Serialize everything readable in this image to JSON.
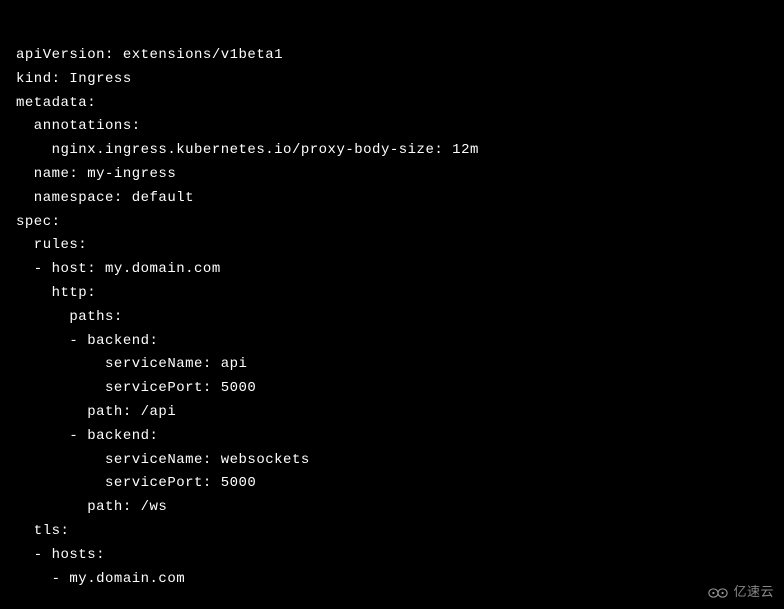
{
  "code": {
    "lines": [
      "apiVersion: extensions/v1beta1",
      "kind: Ingress",
      "metadata:",
      "  annotations:",
      "    nginx.ingress.kubernetes.io/proxy-body-size: 12m",
      "  name: my-ingress",
      "  namespace: default",
      "spec:",
      "  rules:",
      "  - host: my.domain.com",
      "    http:",
      "      paths:",
      "      - backend:",
      "          serviceName: api",
      "          servicePort: 5000",
      "        path: /api",
      "      - backend:",
      "          serviceName: websockets",
      "          servicePort: 5000",
      "        path: /ws",
      "  tls:",
      "  - hosts:",
      "    - my.domain.com"
    ]
  },
  "watermark": {
    "text": "亿速云"
  }
}
